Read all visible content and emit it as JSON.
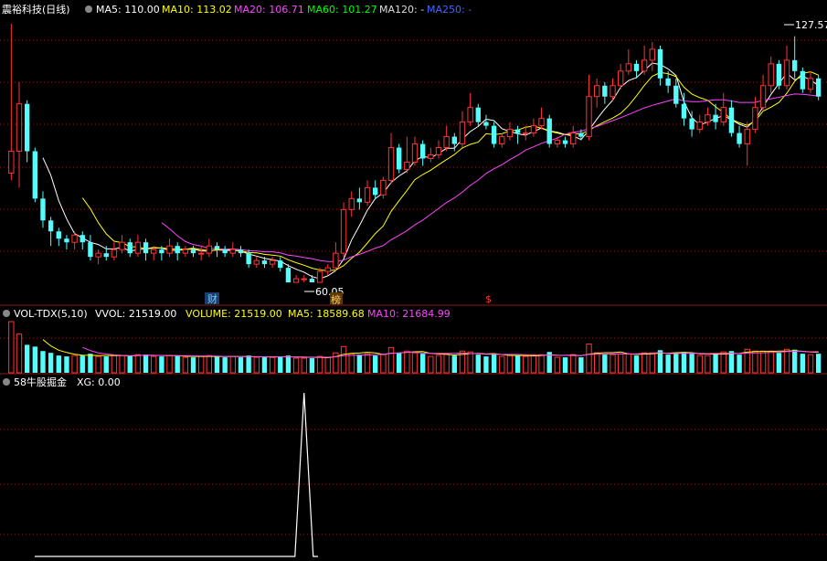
{
  "panels": {
    "price": {
      "title": "震裕科技(日线)",
      "ma": [
        {
          "label": "MA5: 110.00",
          "color": "#ffffff"
        },
        {
          "label": "MA10: 113.02",
          "color": "#ffff00"
        },
        {
          "label": "MA20: 106.71",
          "color": "#ff44ff"
        },
        {
          "label": "MA60: 101.27",
          "color": "#00ff00"
        },
        {
          "label": "MA120: -",
          "color": "#dddddd"
        },
        {
          "label": "MA250: -",
          "color": "#4466ff"
        }
      ],
      "high_label": "127.57",
      "low_label": "60.05",
      "event_markers": [
        {
          "text": "财",
          "color": "#66ccff"
        },
        {
          "text": "榜",
          "color": "#ffcc66"
        },
        {
          "text": "$",
          "color": "#ff3333"
        }
      ]
    },
    "volume": {
      "title": "VOL-TDX(5,10)",
      "labels": [
        {
          "label": "VVOL: 21519.00",
          "color": "#ffffff"
        },
        {
          "label": "VOLUME: 21519.00",
          "color": "#ffff00"
        },
        {
          "label": "MA5: 18589.68",
          "color": "#ffff00"
        },
        {
          "label": "MA10: 21684.99",
          "color": "#ff44ff"
        }
      ]
    },
    "indicator": {
      "title": "58牛股掘金",
      "labels": [
        {
          "label": "XG: 0.00",
          "color": "#ffffff"
        }
      ]
    }
  },
  "colors": {
    "up": "#ff3333",
    "down": "#54fcfc",
    "grid": "#8b1a1a",
    "background": "#000000",
    "ma5": "#ffffff",
    "ma10": "#ffff00",
    "ma20": "#ff44ff",
    "ma60": "#00ff00"
  },
  "chart_data": {
    "type": "candlestick",
    "x_axis_printed": false,
    "y_axis_printed": false,
    "ylim": [
      56,
      132
    ],
    "series_candles": [
      [
        90,
        96,
        131,
        88
      ],
      [
        96,
        109,
        115,
        86
      ],
      [
        109,
        96,
        110,
        93
      ],
      [
        96,
        83,
        97,
        82
      ],
      [
        83,
        77,
        85,
        75
      ],
      [
        77,
        74,
        78,
        70
      ],
      [
        74,
        72,
        75,
        70
      ],
      [
        72,
        71,
        73,
        69
      ],
      [
        71,
        73,
        74,
        69
      ],
      [
        73,
        71,
        74,
        69
      ],
      [
        71,
        67,
        73,
        66
      ],
      [
        67,
        68,
        69,
        65
      ],
      [
        68,
        67,
        70,
        66
      ],
      [
        67,
        69,
        71,
        66
      ],
      [
        69,
        71,
        73,
        68
      ],
      [
        71,
        68,
        72,
        67
      ],
      [
        68,
        71,
        73,
        67
      ],
      [
        71,
        68,
        72,
        66
      ],
      [
        68,
        69,
        70,
        66
      ],
      [
        69,
        68,
        70,
        66
      ],
      [
        68,
        70,
        72,
        67
      ],
      [
        70,
        68,
        71,
        66
      ],
      [
        68,
        69,
        70,
        67
      ],
      [
        69,
        68,
        70,
        67
      ],
      [
        68,
        68,
        70,
        66
      ],
      [
        68,
        70,
        72,
        67
      ],
      [
        70,
        69,
        71,
        67
      ],
      [
        69,
        68,
        70,
        67
      ],
      [
        68,
        69,
        71,
        67
      ],
      [
        69,
        68,
        70,
        67
      ],
      [
        68,
        65,
        69,
        64
      ],
      [
        65,
        66,
        67,
        64
      ],
      [
        66,
        65,
        67,
        64
      ],
      [
        65,
        66,
        67,
        64
      ],
      [
        66,
        64,
        67,
        63
      ],
      [
        64,
        60,
        65,
        60
      ],
      [
        60,
        61,
        62,
        60
      ],
      [
        61,
        61,
        62,
        60
      ],
      [
        61,
        60,
        62,
        60
      ],
      [
        60,
        63,
        64,
        60
      ],
      [
        63,
        64,
        65,
        62
      ],
      [
        64,
        68,
        71,
        63
      ],
      [
        68,
        80,
        82,
        67
      ],
      [
        80,
        83,
        85,
        78
      ],
      [
        83,
        82,
        86,
        80
      ],
      [
        82,
        86,
        88,
        81
      ],
      [
        86,
        84,
        88,
        83
      ],
      [
        84,
        88,
        89,
        83
      ],
      [
        88,
        97,
        101,
        87
      ],
      [
        97,
        91,
        98,
        90
      ],
      [
        91,
        93,
        100,
        90
      ],
      [
        93,
        98,
        100,
        92
      ],
      [
        98,
        94,
        99,
        92
      ],
      [
        94,
        95,
        97,
        93
      ],
      [
        95,
        97,
        99,
        94
      ],
      [
        97,
        100,
        103,
        96
      ],
      [
        100,
        98,
        101,
        96
      ],
      [
        98,
        104,
        107,
        97
      ],
      [
        104,
        108,
        112,
        103
      ],
      [
        108,
        104,
        109,
        103
      ],
      [
        104,
        103,
        106,
        102
      ],
      [
        103,
        98,
        104,
        97
      ],
      [
        98,
        100,
        101,
        97
      ],
      [
        100,
        102,
        104,
        99
      ],
      [
        102,
        101,
        103,
        98
      ],
      [
        101,
        101,
        103,
        99
      ],
      [
        101,
        103,
        105,
        100
      ],
      [
        103,
        105,
        108,
        102
      ],
      [
        105,
        98,
        106,
        97
      ],
      [
        98,
        99,
        100,
        97
      ],
      [
        99,
        98,
        100,
        97
      ],
      [
        98,
        101,
        103,
        97
      ],
      [
        101,
        100,
        102,
        99
      ],
      [
        100,
        111,
        117,
        99
      ],
      [
        111,
        114,
        116,
        108
      ],
      [
        114,
        111,
        115,
        109
      ],
      [
        111,
        114,
        116,
        110
      ],
      [
        114,
        118,
        120,
        113
      ],
      [
        118,
        120,
        124,
        117
      ],
      [
        120,
        118,
        121,
        116
      ],
      [
        118,
        121,
        125,
        117
      ],
      [
        121,
        124,
        126,
        118
      ],
      [
        124,
        116,
        125,
        114
      ],
      [
        116,
        114,
        118,
        112
      ],
      [
        114,
        109,
        116,
        108
      ],
      [
        109,
        105,
        112,
        103
      ],
      [
        105,
        102,
        107,
        100
      ],
      [
        102,
        104,
        106,
        101
      ],
      [
        104,
        106,
        108,
        103
      ],
      [
        106,
        104,
        109,
        102
      ],
      [
        104,
        108,
        112,
        103
      ],
      [
        108,
        101,
        110,
        100
      ],
      [
        101,
        98,
        103,
        97
      ],
      [
        98,
        102,
        104,
        92
      ],
      [
        102,
        108,
        111,
        101
      ],
      [
        108,
        114,
        117,
        107
      ],
      [
        114,
        120,
        122,
        112
      ],
      [
        120,
        114,
        121,
        113
      ],
      [
        114,
        121,
        125,
        113
      ],
      [
        121,
        118,
        127.57,
        116
      ],
      [
        118,
        113,
        119,
        112
      ],
      [
        113,
        116,
        118,
        112
      ],
      [
        116,
        111,
        117,
        110
      ]
    ],
    "ma5": [
      null,
      null,
      null,
      null,
      94.2,
      89.4,
      82.4,
      77.4,
      73.4,
      72.2,
      71.0,
      70.4,
      69.2,
      69.2,
      69.6,
      68.6,
      69.0,
      69.2,
      69.6,
      69.4,
      68.8,
      68.8,
      69.0,
      69.2,
      68.6,
      68.6,
      69.0,
      68.8,
      68.8,
      68.6,
      67.8,
      67.2,
      66.6,
      66.2,
      65.8,
      64.6,
      63.6,
      62.8,
      61.6,
      61.0,
      61.8,
      63.2,
      66.4,
      71.6,
      75.6,
      79.8,
      83.0,
      84.6,
      87.4,
      89.2,
      90.6,
      93.4,
      94.6,
      94.2,
      95.4,
      96.8,
      96.8,
      99.4,
      101.4,
      102.8,
      104.8,
      104.4,
      102.2,
      101.4,
      100.8,
      100.4,
      101.4,
      102.4,
      101.6,
      101.2,
      100.6,
      100.2,
      99.2,
      101.8,
      104.8,
      107.6,
      110.0,
      113.6,
      115.4,
      116.2,
      118.2,
      120.2,
      119.8,
      118.6,
      116.8,
      109.6,
      105.2,
      103.2,
      104.0,
      105.0,
      105.8,
      104.6,
      103.4,
      102.6,
      104.6,
      108.2,
      111.6,
      114.6,
      117.4,
      115.6,
      116.6,
      115.6,
      114.0
    ],
    "ma10": [
      null,
      null,
      null,
      null,
      null,
      null,
      null,
      null,
      null,
      83.2,
      80.2,
      76.4,
      73.3,
      71.3,
      70.9,
      69.8,
      69.7,
      69.2,
      69.4,
      69.5,
      69.2,
      69.1,
      69.1,
      69.4,
      69.0,
      68.7,
      68.9,
      68.9,
      69.0,
      68.6,
      68.2,
      68.1,
      67.7,
      67.5,
      67.2,
      66.2,
      65.4,
      64.7,
      63.9,
      63.4,
      63.2,
      63.4,
      64.6,
      66.6,
      68.3,
      70.8,
      73.4,
      75.5,
      79.5,
      82.4,
      85.2,
      88.2,
      89.6,
      90.8,
      92.3,
      93.7,
      95.1,
      96.9,
      97.9,
      98.5,
      100.8,
      100.6,
      100.8,
      101.6,
      101.8,
      102.6,
      102.9,
      102.3,
      101.5,
      101.0,
      100.5,
      100.8,
      100.8,
      101.7,
      103.0,
      104.1,
      105.1,
      106.4,
      108.5,
      111.2,
      114.1,
      116.6,
      117.6,
      117.3,
      116.5,
      113.6,
      111.7,
      110.7,
      110.0,
      108.2,
      106.6,
      104.8,
      103.8,
      103.1,
      104.3,
      107.0,
      108.1,
      109.4,
      111.9,
      115.2,
      117.4,
      117.8,
      116.9
    ],
    "ma20": [
      null,
      null,
      null,
      null,
      null,
      null,
      null,
      null,
      null,
      null,
      null,
      null,
      null,
      null,
      null,
      null,
      null,
      null,
      null,
      76.4,
      74.7,
      72.8,
      71.2,
      70.4,
      70.0,
      69.3,
      69.3,
      69.1,
      69.2,
      69.0,
      68.7,
      68.6,
      68.4,
      68.4,
      68.1,
      67.5,
      67.2,
      66.8,
      66.5,
      66.0,
      65.7,
      65.7,
      66.1,
      67.0,
      67.7,
      68.5,
      69.4,
      70.1,
      71.7,
      72.9,
      74.2,
      75.8,
      77.1,
      78.7,
      80.3,
      81.9,
      83.2,
      84.8,
      86.6,
      88.1,
      89.9,
      91.2,
      92.3,
      93.7,
      94.9,
      96.3,
      97.2,
      98.2,
      98.9,
      99.6,
      100.7,
      101.2,
      101.5,
      102.2,
      102.8,
      103.6,
      104.4,
      105.2,
      106.1,
      107.0,
      107.9,
      108.6,
      109.2,
      109.8,
      110.4,
      109.8,
      109.6,
      109.6,
      109.9,
      110.1,
      110.1,
      109.8,
      109.4,
      109.4,
      109.4,
      110.0,
      110.4,
      110.8,
      111.3,
      111.7,
      111.6,
      111.4,
      111.1
    ],
    "ma60": [],
    "volume_printed": false,
    "indicator_signal_index": 37,
    "indicator_signal_value": 1,
    "indicator_current": 0
  }
}
